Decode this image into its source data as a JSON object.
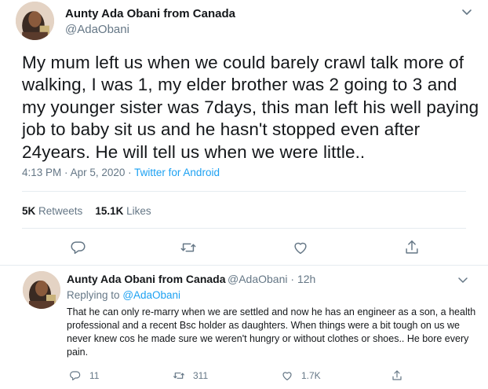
{
  "tweet": {
    "author_name": "Aunty Ada Obani from Canada",
    "author_handle": "@AdaObani",
    "text": "My mum left us when we could barely crawl talk more of walking, I was 1, my elder brother was 2 going to 3 and my younger sister was 7days, this man left his well paying job to baby sit us and he hasn't stopped even after 24years. He will tell us when we were little..",
    "time": "4:13 PM",
    "date": "Apr 5, 2020",
    "separator": "·",
    "source": "Twitter for Android",
    "retweets_count": "5K",
    "retweets_label": "Retweets",
    "likes_count": "15.1K",
    "likes_label": "Likes",
    "actions": [
      {
        "icon": "reply-icon"
      },
      {
        "icon": "retweet-icon"
      },
      {
        "icon": "like-icon"
      },
      {
        "icon": "share-icon"
      }
    ]
  },
  "reply": {
    "author_name": "Aunty Ada Obani from Canada",
    "author_handle": "@AdaObani",
    "separator": "·",
    "age": "12h",
    "replying_label": "Replying to",
    "replying_to": "@AdaObani",
    "text": "That he can only re-marry when we are settled and now he has an engineer as a son, a health professional and a recent Bsc holder as daughters. When things were a bit tough on us we never knew cos he made sure we weren't hungry or without clothes or shoes.. He bore every pain.",
    "reply_count": "11",
    "retweet_count": "311",
    "like_count": "1.7K"
  },
  "colors": {
    "text_primary": "#14171a",
    "text_secondary": "#657786",
    "accent": "#1da1f2",
    "divider": "#e6ecf0"
  }
}
